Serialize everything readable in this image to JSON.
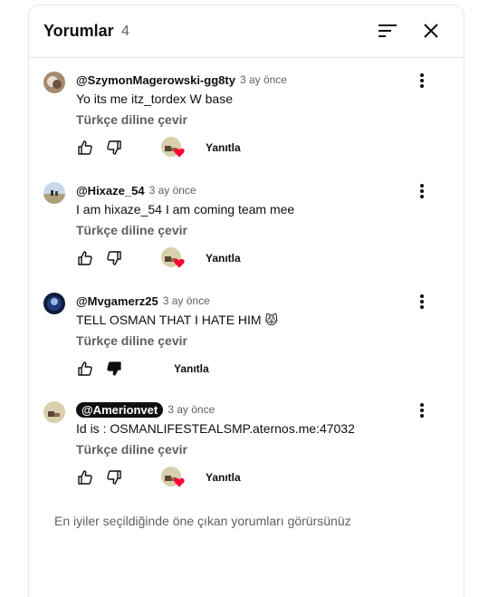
{
  "header": {
    "title": "Yorumlar",
    "count": "4"
  },
  "comments": [
    {
      "author": "@SzymonMagerowski-gg8ty",
      "time": "3 ay önce",
      "text": "Yo its me itz_tordex W base",
      "translate": "Türkçe diline çevir",
      "reply": "Yanıtla",
      "creator_heart": true,
      "disliked": false,
      "highlight_author": false
    },
    {
      "author": "@Hixaze_54",
      "time": "3 ay önce",
      "text": "I am hixaze_54 I am coming team mee",
      "translate": "Türkçe diline çevir",
      "reply": "Yanıtla",
      "creator_heart": true,
      "disliked": false,
      "highlight_author": false
    },
    {
      "author": "@Mvgamerz25",
      "time": "3 ay önce",
      "text": "TELL OSMAN THAT I HATE HIM 😾",
      "translate": "Türkçe diline çevir",
      "reply": "Yanıtla",
      "creator_heart": false,
      "disliked": true,
      "highlight_author": false
    },
    {
      "author": "@Amerionvet",
      "time": "3 ay önce",
      "text": "Id is : OSMANLIFESTEALSMP.aternos.me:47032",
      "translate": "Türkçe diline çevir",
      "reply": "Yanıtla",
      "creator_heart": true,
      "disliked": false,
      "highlight_author": true
    }
  ],
  "footer": {
    "note": "En iyiler seçildiğinde öne çıkan yorumları görürsünüz"
  },
  "colors": {
    "heart": "#ff0033",
    "text_secondary": "#606060",
    "border": "#e5e5e5"
  }
}
